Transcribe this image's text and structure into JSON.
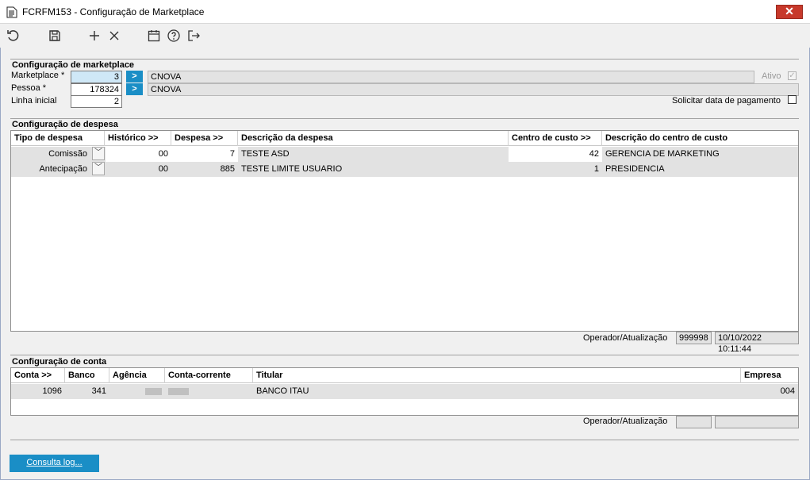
{
  "window": {
    "title": "FCRFM153 - Configuração de Marketplace",
    "close_label": "✕"
  },
  "toolbar": {
    "icons": [
      "refresh-icon",
      "save-icon",
      "add-icon",
      "delete-icon",
      "calendar-icon",
      "help-icon",
      "exit-icon"
    ]
  },
  "marketplace_section": {
    "title": "Configuração de marketplace",
    "marketplace_label": "Marketplace *",
    "marketplace_value": "3",
    "marketplace_name": "CNOVA",
    "pessoa_label": "Pessoa *",
    "pessoa_value": "178324",
    "pessoa_name": "CNOVA",
    "linha_label": "Linha inicial",
    "linha_value": "2",
    "ativo_label": "Ativo",
    "ativo_checked": true,
    "solicitar_label": "Solicitar data de pagamento",
    "solicitar_checked": false
  },
  "despesa_section": {
    "title": "Configuração de despesa",
    "columns": [
      "Tipo de despesa",
      "Histórico >>",
      "Despesa >>",
      "Descrição da despesa",
      "Centro de custo >>",
      "Descrição do centro de custo"
    ],
    "rows": [
      {
        "tipo": "Comissão",
        "historico": "00",
        "despesa": "7",
        "descricao": "TESTE ASD",
        "centro": "42",
        "desc_centro": "GERENCIA DE MARKETING"
      },
      {
        "tipo": "Antecipação",
        "historico": "00",
        "despesa": "885",
        "descricao": "TESTE LIMITE USUARIO",
        "centro": "1",
        "desc_centro": "PRESIDENCIA"
      }
    ],
    "operador_label": "Operador/Atualização",
    "operador_value": "999998",
    "atualizacao_value": "10/10/2022 10:11:44"
  },
  "conta_section": {
    "title": "Configuração de conta",
    "columns": [
      "Conta >>",
      "Banco",
      "Agência",
      "Conta-corrente",
      "Titular",
      "Empresa"
    ],
    "rows": [
      {
        "conta": "1096",
        "banco": "341",
        "agencia": "",
        "conta_corrente": "",
        "titular": "BANCO ITAU",
        "empresa": "004"
      }
    ],
    "operador_label": "Operador/Atualização",
    "operador_value": "",
    "atualizacao_value": ""
  },
  "footer": {
    "log_button": "Consulta log..."
  },
  "colors": {
    "accent": "#1a8ec6",
    "close": "#c7392b",
    "row_bg": "#e2e2e2"
  }
}
